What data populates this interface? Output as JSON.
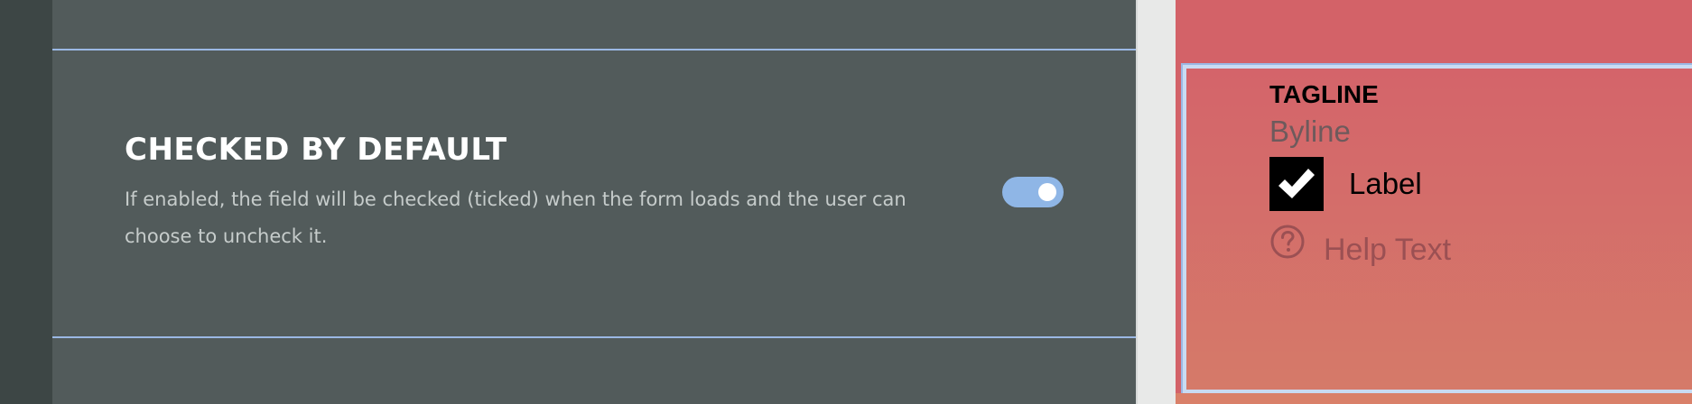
{
  "setting": {
    "title": "CHECKED BY DEFAULT",
    "description": "If enabled, the field will be checked (ticked) when the form loads and the user can choose to uncheck it.",
    "toggle_enabled": true
  },
  "preview": {
    "tagline": "TAGLINE",
    "byline": "Byline",
    "checkbox_label": "Label",
    "checkbox_checked": true,
    "help_text": "Help Text"
  },
  "colors": {
    "sidebar": "#3d4645",
    "panel": "#525b5b",
    "accent": "#8fb6e6",
    "preview_top": "#d4646a",
    "preview_bottom": "#d57a69"
  },
  "icons": {
    "toggle": "toggle-switch-icon",
    "checkmark": "checkmark-icon",
    "help": "question-circle-icon"
  }
}
